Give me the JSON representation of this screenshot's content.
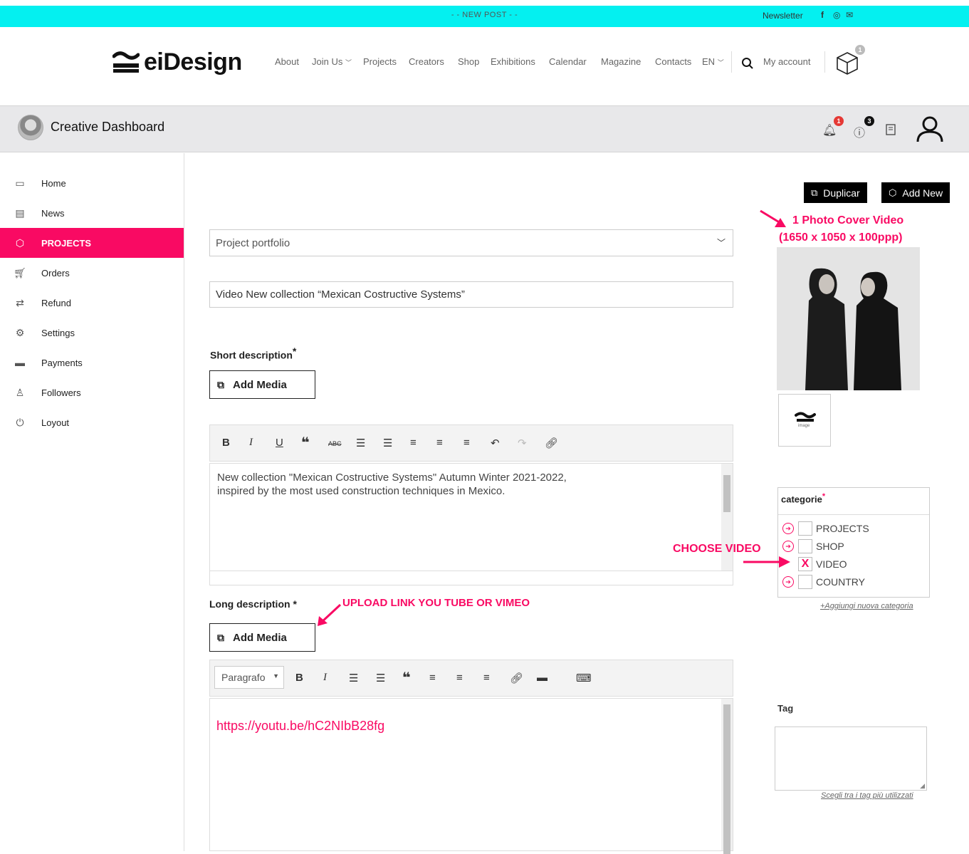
{
  "topbar": {
    "banner": "- - NEW POST - -",
    "newsletter": "Newsletter",
    "social_facebook": "f",
    "social_instagram": "◎",
    "social_mail": "✉"
  },
  "brand": {
    "logo_text": "eiDesign"
  },
  "nav": {
    "about": "About",
    "join_us": "Join Us",
    "projects": "Projects",
    "creators": "Creators",
    "shop": "Shop",
    "exhibitions": "Exhibitions",
    "calendar": "Calendar",
    "magazine": "Magazine",
    "contacts": "Contacts",
    "language": "EN",
    "my_account": "My account",
    "cart_count": "1"
  },
  "dashboard": {
    "title": "Creative Dashboard",
    "notif_count": "1",
    "help_count": "3"
  },
  "sidebar": {
    "items": [
      {
        "label": "Home",
        "icon": "monitor-icon"
      },
      {
        "label": "News",
        "icon": "document-icon"
      },
      {
        "label": "PROJECTS",
        "icon": "cube-icon"
      },
      {
        "label": "Orders",
        "icon": "cart-icon"
      },
      {
        "label": "Refund",
        "icon": "refund-icon"
      },
      {
        "label": "Settings",
        "icon": "gears-icon"
      },
      {
        "label": "Payments",
        "icon": "card-icon"
      },
      {
        "label": "Followers",
        "icon": "shirt-icon"
      },
      {
        "label": "Loyout",
        "icon": "power-icon"
      }
    ],
    "active_index": 2
  },
  "form": {
    "portfolio_select": "Project portfolio",
    "title_value": "Video New collection “Mexican Costructive Systems”",
    "short_desc_label": "Short description",
    "required_mark": "*",
    "add_media_label": "Add Media",
    "short_desc_text_line1": "New collection \"Mexican Costructive Systems\" Autumn Winter 2021-2022,",
    "short_desc_text_line2": "inspired by the most used construction techniques in Mexico.",
    "long_desc_label": "Long description",
    "paragraph_select": "Paragrafo",
    "long_desc_link": "https://youtu.be/hC2NIbB28fg"
  },
  "annotations": {
    "photo_cover_line1": "1 Photo Cover Video",
    "photo_cover_line2": "(1650 x 1050 x 100ppp)",
    "choose_video": "CHOOSE VIDEO",
    "upload_link": "UPLOAD LINK YOU TUBE OR VIMEO"
  },
  "right": {
    "duplicate_label": "Duplicar",
    "add_new_label": "Add New",
    "thumb_caption": "image",
    "categories_label": "categorie",
    "categories": [
      {
        "label": "PROJECTS",
        "checked": ""
      },
      {
        "label": "SHOP",
        "checked": ""
      },
      {
        "label": "VIDEO",
        "checked": "X"
      },
      {
        "label": "COUNTRY",
        "checked": ""
      }
    ],
    "add_category_link": "+Aggiungi nuova categoria",
    "tag_label": "Tag",
    "tag_link": "Scegli tra i tag più utilizzati"
  },
  "colors": {
    "accent": "#f90a63",
    "topbar": "#04f0f0"
  }
}
